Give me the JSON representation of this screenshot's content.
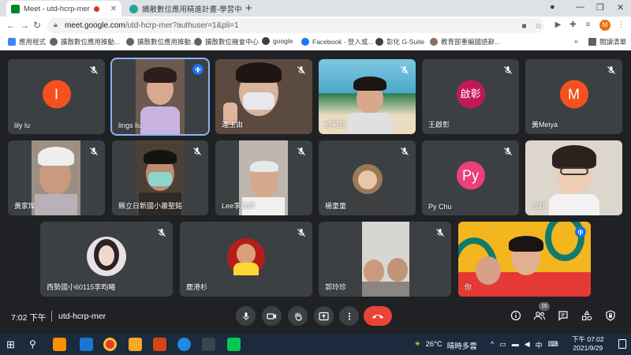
{
  "browser": {
    "tabs": [
      {
        "title": "Meet - utd-hcrp-mer",
        "active": true,
        "recording": true
      },
      {
        "title": "擴散數位應用精進計畫-學習中心",
        "active": false
      }
    ],
    "url_host": "meet.google.com",
    "url_path": "/utd-hcrp-mer?authuser=1&pli=1",
    "profile_initial": "M",
    "bookmarks": [
      "應用程式",
      "擴散數位應用推動...",
      "擴散數位應用推動...",
      "擴散數位機會中心",
      "google",
      "Facebook - 登入或...",
      "彰化 G-Suite",
      "教育部重編國語辭..."
    ],
    "reading_list": "閱讀清單"
  },
  "participants": [
    {
      "name": "lily lu",
      "avatar_letter": "I",
      "avatar_color": "#f4511e",
      "video": false
    },
    {
      "name": "lings liu",
      "video": true,
      "speaking": true
    },
    {
      "name": "連玉由",
      "video": true
    },
    {
      "name": "許莉芸",
      "video": true
    },
    {
      "name": "王啟彰",
      "avatar_letter": "啟彰",
      "avatar_color": "#c2185b",
      "video": false
    },
    {
      "name": "黃Meiya",
      "avatar_letter": "M",
      "avatar_color": "#f4511e",
      "video": false
    },
    {
      "name": "黃家璨",
      "video": true
    },
    {
      "name": "縣立日新國小蕭聖銘",
      "video": true
    },
    {
      "name": "Lee李建師",
      "video": true
    },
    {
      "name": "楊童童",
      "video": true
    },
    {
      "name": "Py Chu",
      "avatar_letter": "Py",
      "avatar_color": "#ec407a",
      "video": false
    },
    {
      "name": "官紅",
      "video": true
    },
    {
      "name": "西勢國小60115李昀曦",
      "video": true
    },
    {
      "name": "鹿港杉",
      "video": true
    },
    {
      "name": "郭玲珍",
      "video": true
    },
    {
      "name": "你",
      "video": true,
      "speaking": true
    }
  ],
  "controls": {
    "time": "7:02 下午",
    "meeting_code": "utd-hcrp-mer",
    "people_count": "16"
  },
  "taskbar": {
    "temperature": "26°C",
    "weather": "晴時多雲",
    "ime": "中",
    "clock_time": "下午 07:02",
    "clock_date": "2021/9/29"
  }
}
